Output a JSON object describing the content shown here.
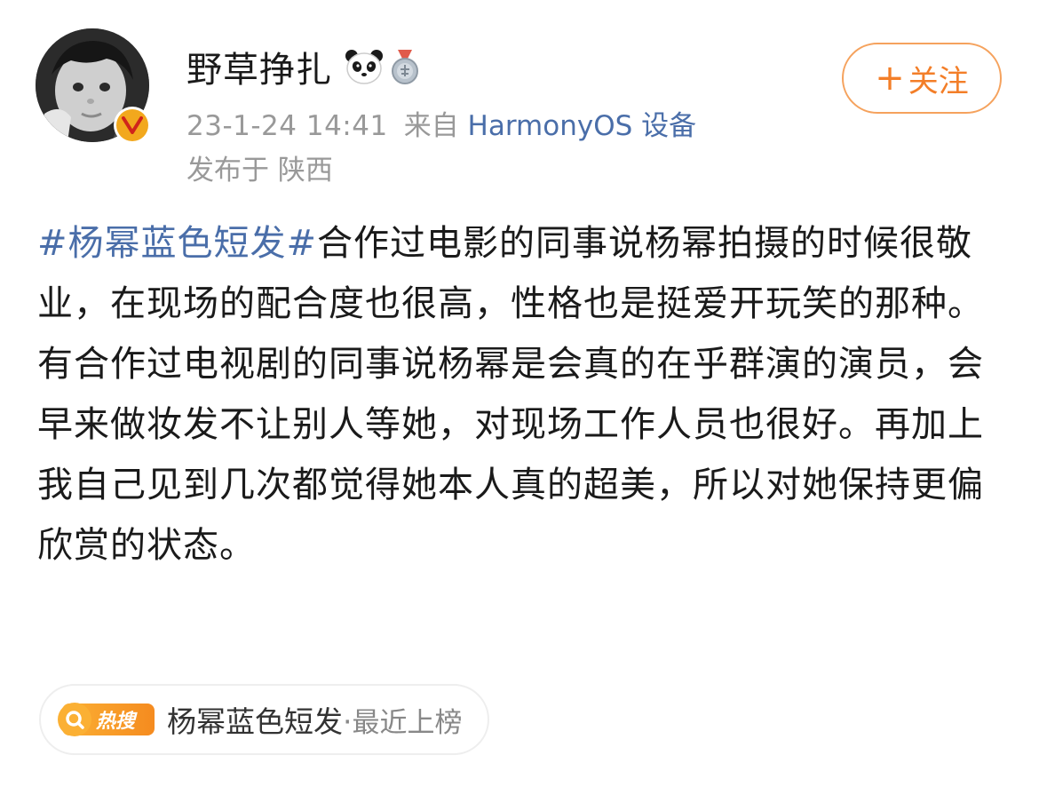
{
  "user": {
    "name": "野草挣扎",
    "time": "23-1-24 14:41",
    "source_prefix": "来自",
    "source": "HarmonyOS 设备",
    "location": "发布于 陕西"
  },
  "follow_button": {
    "plus": "+",
    "label": "关注"
  },
  "post": {
    "hashtag": "#杨幂蓝色短发#",
    "text": "合作过电影的同事说杨幂拍摄的时候很敬业，在现场的配合度也很高，性格也是挺爱开玩笑的那种。有合作过电视剧的同事说杨幂是会真的在乎群演的演员，会早来做妆发不让别人等她，对现场工作人员也很好。再加上我自己见到几次都觉得她本人真的超美，所以对她保持更偏欣赏的状态。"
  },
  "hot_search": {
    "logo_label": "热搜",
    "topic": "杨幂蓝色短发",
    "separator": "·",
    "status": "最近上榜"
  },
  "colors": {
    "link": "#4a6ea9",
    "follow": "#f37e28",
    "meta": "#999999",
    "hot": "#f9a825"
  },
  "icons": {
    "badge": "vip-v-icon",
    "emoji": "panda-emoji-icon",
    "medal": "medal-icon",
    "hot": "hot-search-icon"
  }
}
